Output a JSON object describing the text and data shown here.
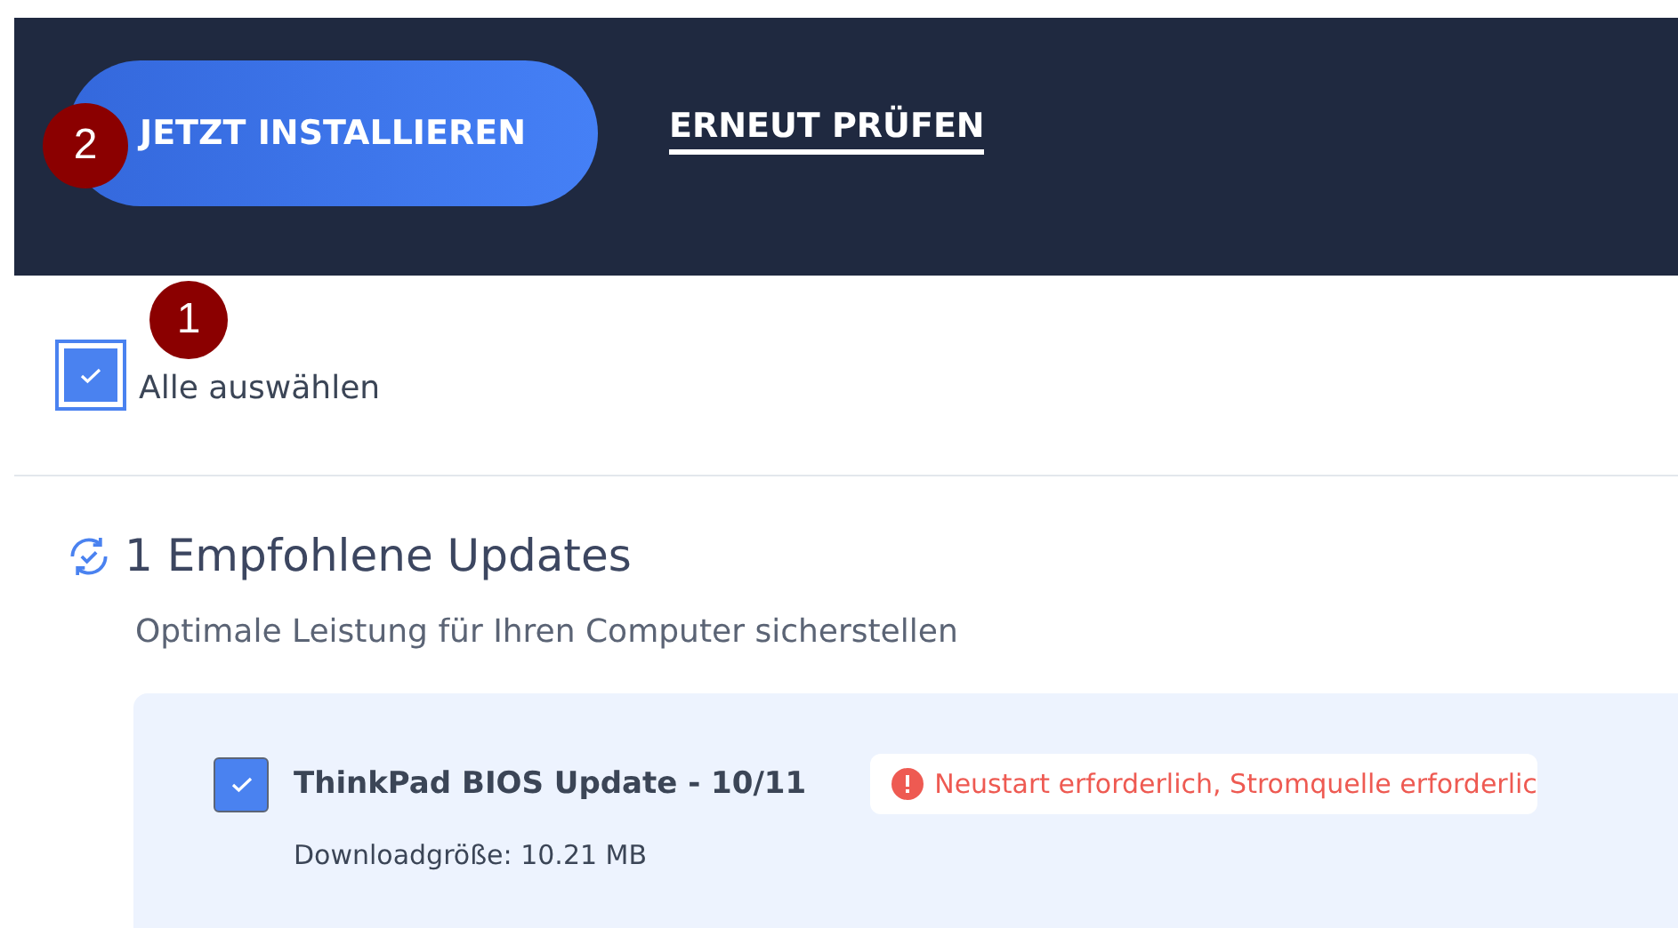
{
  "header": {
    "buttons": [
      {
        "label": "JETZT INSTALLIEREN",
        "kind": "primary"
      },
      {
        "label": "ERNEUT PRÜFEN",
        "kind": "link"
      }
    ]
  },
  "callouts": [
    {
      "label": "2"
    },
    {
      "label": "1"
    }
  ],
  "select_all": {
    "label": "Alle auswählen",
    "checked": true
  },
  "section": {
    "title": "1 Empfohlene Updates",
    "subtitle": "Optimale Leistung für Ihren Computer sicherstellen",
    "updates": [
      {
        "name": "ThinkPad BIOS Update - 10/11",
        "checked": true,
        "warning": "Neustart erforderlich, Stromquelle erforderlic",
        "size": "Downloadgröße: 10.21 MB"
      }
    ]
  }
}
